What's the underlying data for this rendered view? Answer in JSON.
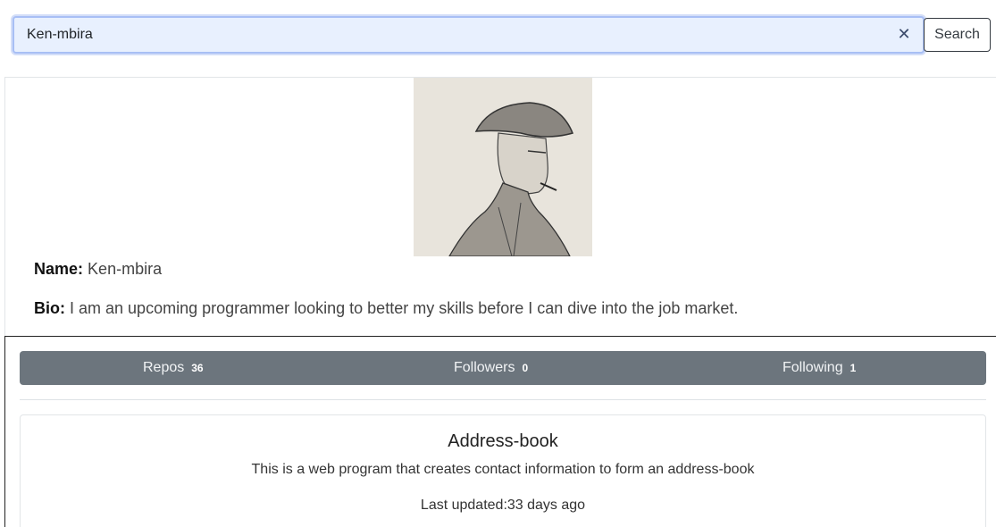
{
  "search": {
    "value": "Ken-mbira",
    "clear_icon": "close-icon",
    "button_label": "Search"
  },
  "profile": {
    "avatar_icon": "avatar-sketch",
    "name_label": "Name:",
    "name": "Ken-mbira",
    "bio_label": "Bio:",
    "bio": "I am an upcoming programmer looking to better my skills before I can dive into the job market."
  },
  "stats": [
    {
      "label": "Repos",
      "count": "36"
    },
    {
      "label": "Followers",
      "count": "0"
    },
    {
      "label": "Following",
      "count": "1"
    }
  ],
  "repos": [
    {
      "name": "Address-book",
      "description": "This is a web program that creates contact information to form an address-book",
      "updated": "Last updated:33 days ago"
    }
  ],
  "colors": {
    "stats_bar": "#6c757d",
    "input_bg": "#e8f0fe"
  }
}
